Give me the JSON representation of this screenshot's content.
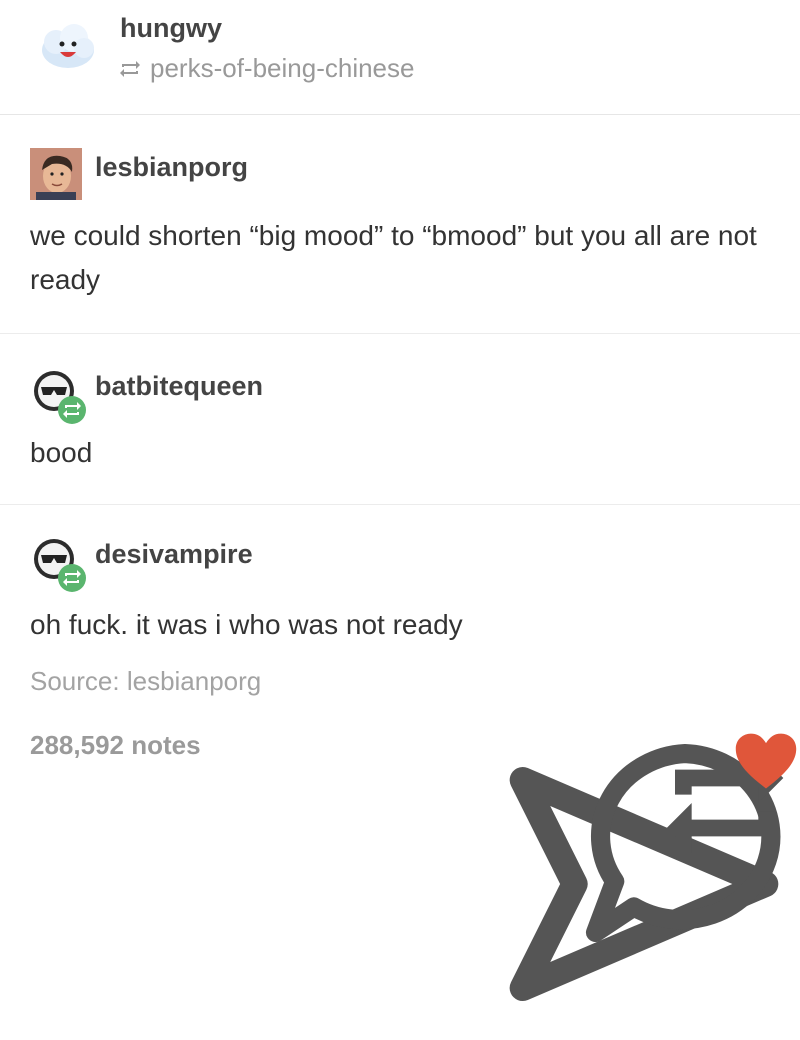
{
  "header": {
    "username": "hungwy",
    "reblogged_from": "perks-of-being-chinese",
    "avatar_icon": "cloud-face-icon",
    "reblog_icon": "reblog-icon"
  },
  "posts": [
    {
      "username": "lesbianporg",
      "avatar_icon": "portrait-avatar-icon",
      "text": "we could shorten “big mood” to “bmood” but you all are not ready"
    },
    {
      "username": "batbitequeen",
      "avatar_icon": "sunglasses-avatar-icon",
      "badge_icon": "reblog-badge-icon",
      "text": "bood"
    },
    {
      "username": "desivampire",
      "avatar_icon": "sunglasses-avatar-icon",
      "badge_icon": "reblog-badge-icon",
      "text": "oh fuck. it was i who was not ready"
    }
  ],
  "footer": {
    "source": "Source: lesbianporg",
    "notes": "288,592 notes",
    "actions": [
      "share-icon",
      "reply-icon",
      "reblog-icon",
      "like-heart-icon"
    ]
  },
  "colors": {
    "reblog_green": "#5ab56e",
    "heart_red": "#e0563a",
    "muted_text": "#a3a3a3"
  }
}
